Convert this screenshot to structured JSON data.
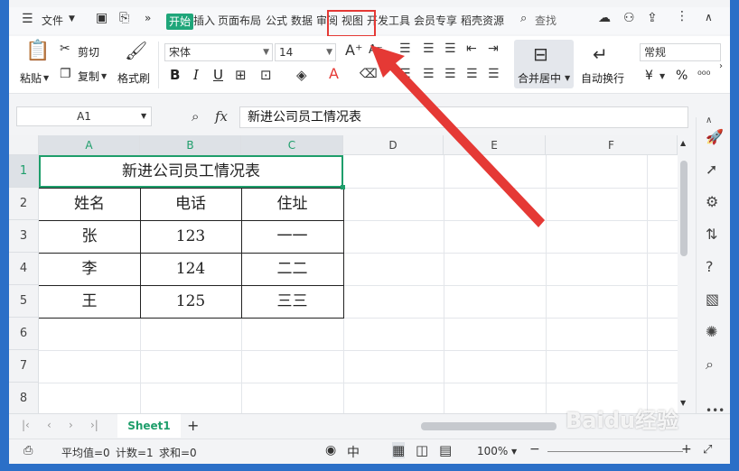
{
  "menu": {
    "file": "文件",
    "tabs": [
      "开始",
      "插入",
      "页面布局",
      "公式",
      "数据",
      "审阅",
      "视图",
      "开发工具",
      "会员专享",
      "稻壳资源"
    ],
    "active_tab": "开始",
    "search": "查找"
  },
  "ribbon": {
    "paste": "粘贴",
    "cut": "剪切",
    "copy": "复制",
    "format_painter": "格式刷",
    "font_name": "宋体",
    "font_size": "14",
    "merge_center": "合并居中",
    "wrap_text": "自动换行",
    "number_format": "常规",
    "currency": "¥",
    "percent": "%",
    "bold": "B",
    "italic": "I",
    "underline": "U"
  },
  "formula_bar": {
    "name_box": "A1",
    "fx": "fx",
    "content": "新进公司员工情况表"
  },
  "columns": [
    "A",
    "B",
    "C",
    "D",
    "E",
    "F"
  ],
  "rows": [
    "1",
    "2",
    "3",
    "4",
    "5",
    "6",
    "7",
    "8"
  ],
  "sheet": {
    "title": "新进公司员工情况表",
    "headers": [
      "姓名",
      "电话",
      "住址"
    ],
    "data": [
      [
        "张",
        "123",
        "一一"
      ],
      [
        "李",
        "124",
        "二二"
      ],
      [
        "王",
        "125",
        "三三"
      ]
    ]
  },
  "sheet_tabs": [
    "Sheet1"
  ],
  "status": {
    "average": "平均值=0",
    "count": "计数=1",
    "sum": "求和=0",
    "zoom": "100%"
  },
  "watermark": "Baidu经验",
  "colors": {
    "accent_green": "#1e9e6b",
    "highlight_red": "#e53935",
    "window_blue": "#2b6fc7"
  }
}
